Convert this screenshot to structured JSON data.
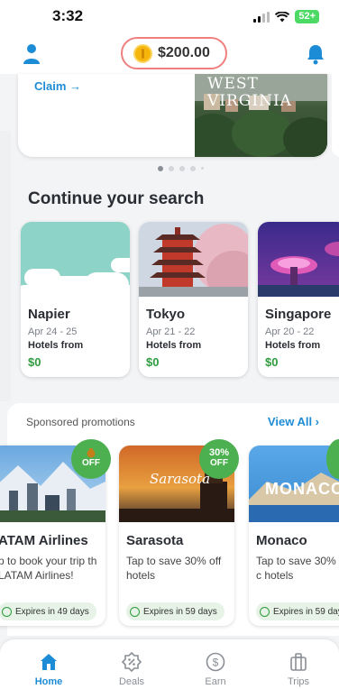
{
  "status_bar": {
    "time": "3:32",
    "battery": "52+"
  },
  "header": {
    "balance": "$200.00",
    "icons": [
      "user-icon",
      "bell-icon"
    ]
  },
  "hero": {
    "claim_label": "Claim →",
    "image_text": "WEST VIRGINIA"
  },
  "continue_section": {
    "title": "Continue your search",
    "cards": [
      {
        "city": "Napier",
        "dates": "Apr 24 -  25",
        "label": "Hotels from",
        "price": "$0"
      },
      {
        "city": "Tokyo",
        "dates": "Apr 21 -  22",
        "label": "Hotels from",
        "price": "$0"
      },
      {
        "city": "Singapore",
        "dates": "Apr 20 -  22",
        "label": "Hotels from",
        "price": "$0"
      }
    ]
  },
  "sponsored": {
    "label": "Sponsored promotions",
    "view_all": "View All ›",
    "promos": [
      {
        "badge": "OFF",
        "name": "ATAM Airlines",
        "desc": "p to book your trip th LATAM Airlines!",
        "expires": "Expires in 49 days"
      },
      {
        "badge_pct": "30%",
        "badge": "OFF",
        "name": "Sarasota",
        "image_text": "Sarasota",
        "desc": "Tap to save 30% off hotels",
        "expires": "Expires in 59 days"
      },
      {
        "name": "Monaco",
        "image_text": "MONACO",
        "desc": "Tap to save 30% c hotels",
        "expires": "Expires in 59 days"
      }
    ]
  },
  "tabbar": {
    "tabs": [
      {
        "label": "Home",
        "icon": "home-icon",
        "active": true
      },
      {
        "label": "Deals",
        "icon": "percent-badge-icon",
        "active": false
      },
      {
        "label": "Earn",
        "icon": "dollar-coin-icon",
        "active": false
      },
      {
        "label": "Trips",
        "icon": "suitcase-icon",
        "active": false
      }
    ]
  },
  "colors": {
    "accent": "#1d8cd6",
    "price_green": "#2e9b3e",
    "balance_border": "#f08080"
  }
}
